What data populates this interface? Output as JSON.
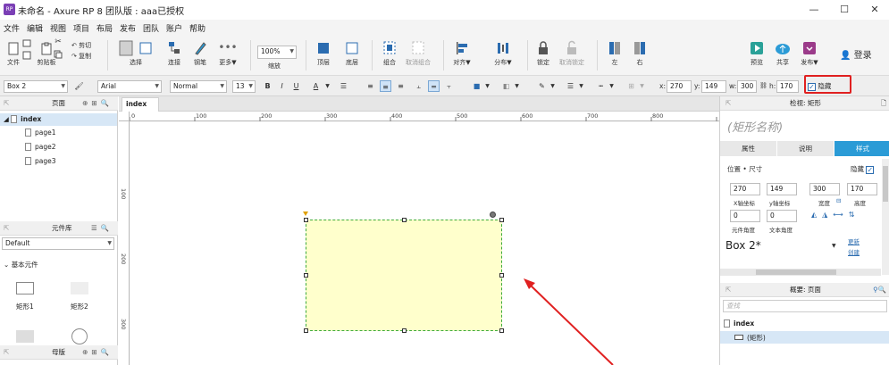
{
  "window": {
    "title": "未命名 - Axure RP 8 团队版 : aaa已授权",
    "icon": "AxureRP icon",
    "minimize": "—",
    "maximize": "☐",
    "close": "✕"
  },
  "menu": [
    "文件",
    "编辑",
    "视图",
    "项目",
    "布局",
    "发布",
    "团队",
    "账户",
    "帮助"
  ],
  "toolbar": {
    "file": "文件",
    "clipboard": "剪贴板",
    "cut": "剪切",
    "copy": "复制",
    "paste": "粘贴",
    "select": "选择",
    "connect": "连接",
    "pen": "钢笔",
    "more": "更多▼",
    "zoom_value": "100%",
    "zoom": "缩放",
    "top": "顶层",
    "bottom": "底层",
    "group": "组合",
    "ungroup": "取消组合",
    "align": "对齐▼",
    "distribute": "分布▼",
    "lock": "锁定",
    "unlock": "取消锁定",
    "left": "左",
    "right": "右",
    "preview": "预览",
    "share": "共享",
    "publish": "发布▼",
    "login": "登录"
  },
  "format": {
    "widget": "Box 2",
    "font": "Arial",
    "style": "Normal",
    "size": "13",
    "bold": "B",
    "italic": "I",
    "underline": "U",
    "font_color": "A",
    "x_label": "x:",
    "x": "270",
    "y_label": "y:",
    "y": "149",
    "w_label": "w:",
    "w": "300",
    "h_label": "h:",
    "h": "170",
    "hidden": "隐藏"
  },
  "pages_panel": {
    "title": "页面",
    "root": "index",
    "pages": [
      "page1",
      "page2",
      "page3"
    ]
  },
  "library_panel": {
    "title": "元件库",
    "library": "Default",
    "group": "基本元件",
    "items": [
      "矩形1",
      "矩形2"
    ]
  },
  "masters_panel": {
    "title": "母版"
  },
  "canvas": {
    "tab": "index",
    "ruler_h": [
      "0",
      "100",
      "200",
      "300",
      "400",
      "500",
      "600",
      "700",
      "800"
    ],
    "ruler_v": [
      "100",
      "200",
      "300"
    ]
  },
  "inspector": {
    "title": "检视: 矩形",
    "name_placeholder": "(矩形名称)",
    "tabs": [
      "属性",
      "说明",
      "样式"
    ],
    "section": "位置 • 尺寸",
    "hidden": "隐藏",
    "x": "270",
    "y": "149",
    "w": "300",
    "h": "170",
    "x_label": "X轴坐标",
    "y_label": "y轴坐标",
    "w_label": "宽度",
    "h_label": "高度",
    "rot": "0",
    "text_rot": "0",
    "rot_label": "元件角度",
    "text_rot_label": "文本角度",
    "style_name": "Box 2*",
    "update": "更新",
    "create": "创建"
  },
  "outline": {
    "title": "概要: 页面",
    "search_placeholder": "查找",
    "root": "index",
    "item": "(矩形)"
  },
  "colors": {
    "accent": "#2b9bd6",
    "annotation": "#e02020",
    "box_fill": "#ffffcc",
    "box_border": "#3caa3c"
  }
}
